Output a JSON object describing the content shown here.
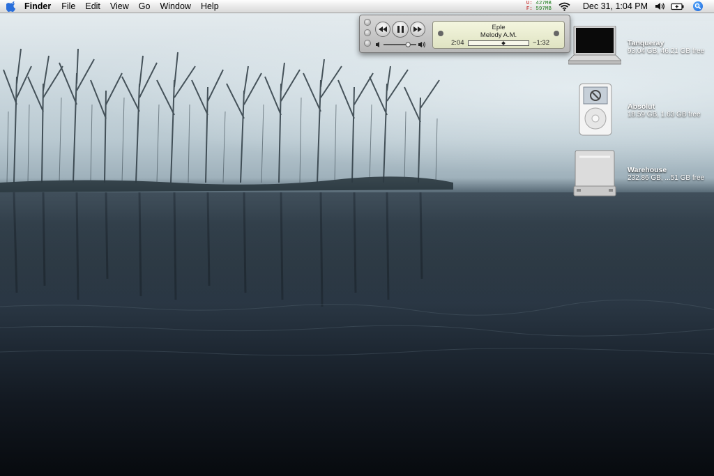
{
  "menubar": {
    "app_name": "Finder",
    "items": [
      "File",
      "Edit",
      "View",
      "Go",
      "Window",
      "Help"
    ],
    "memory": {
      "used_label": "U:",
      "used_value": "427MB",
      "free_label": "F:",
      "free_value": "597MB"
    },
    "clock": "Dec 31, 1:04 PM",
    "icons": [
      "apple-icon",
      "wifi-icon",
      "volume-icon",
      "battery-icon",
      "spotlight-icon"
    ]
  },
  "mini_player": {
    "song": "Eple",
    "artist": "Melody A.M.",
    "elapsed": "2:04",
    "remaining": "−1:32",
    "progress_fraction": 0.58,
    "volume_fraction": 0.75
  },
  "desktop_icons": [
    {
      "name": "Tanqueray",
      "info": "93.04 GB, 46.21 GB free",
      "icon": "laptop-icon"
    },
    {
      "name": "Absolut",
      "info": "18.59 GB, 1.63 GB free",
      "icon": "ipod-icon"
    },
    {
      "name": "Warehouse",
      "info": "232.86 GB, ...51 GB free",
      "icon": "hard-drive-icon"
    }
  ]
}
